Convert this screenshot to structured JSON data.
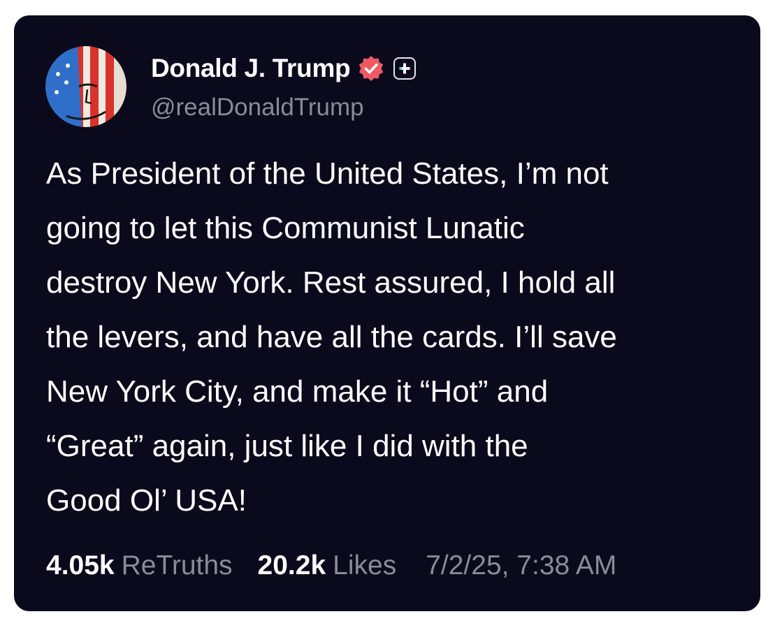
{
  "post": {
    "author": {
      "display_name": "Donald J. Trump",
      "handle": "@realDonaldTrump",
      "verified_icon": "verified-badge-icon",
      "extra_icon": "plus-icon"
    },
    "text_lines": [
      "As President of the United States, I’m not",
      "going to let this Communist Lunatic",
      "destroy New York. Rest assured, I hold all",
      "the levers, and have all the cards. I’ll save",
      "New York City, and make it “Hot” and",
      "“Great” again, just like I did with the",
      "Good Ol’ USA!"
    ],
    "stats": {
      "retruths_count": "4.05k",
      "retruths_label": "ReTruths",
      "likes_count": "20.2k",
      "likes_label": "Likes"
    },
    "timestamp": "7/2/25, 7:38 AM"
  },
  "colors": {
    "card_background": "#0b0a1c",
    "muted_text": "#8a8a99",
    "verified_badge": "#ee5a64"
  }
}
